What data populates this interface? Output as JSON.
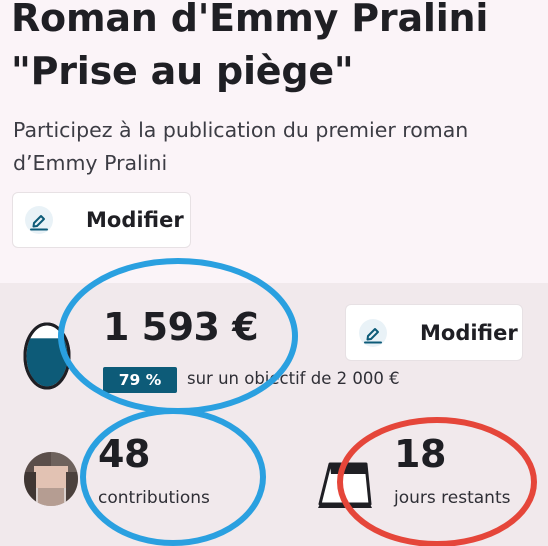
{
  "project": {
    "title_line1": "Roman d'Emmy Pralini",
    "title_line2": "\"Prise au piège\"",
    "subtitle": "Participez à la publication du premier roman d’Emmy Pralini",
    "edit_label": "Modifier"
  },
  "funding": {
    "amount": "1 593 €",
    "percent": "79 %",
    "goal_text": "sur un objectif de 2 000 €",
    "edit_label": "Modifier",
    "progress_fraction": 0.79
  },
  "stats": {
    "contributions_count": "48",
    "contributions_label": "contributions",
    "days_count": "18",
    "days_label": "jours restants"
  },
  "icons": {
    "edit": "pencil-icon",
    "jar": "piggy-jar-icon",
    "calendar": "calendar-icon",
    "avatar": "contributor-avatar"
  },
  "colors": {
    "accent": "#0d5b78",
    "annotation_blue": "#2aa0e0",
    "annotation_red": "#e5463a",
    "top_bg": "#fbf4f8",
    "bottom_bg": "#f1e9ec"
  }
}
